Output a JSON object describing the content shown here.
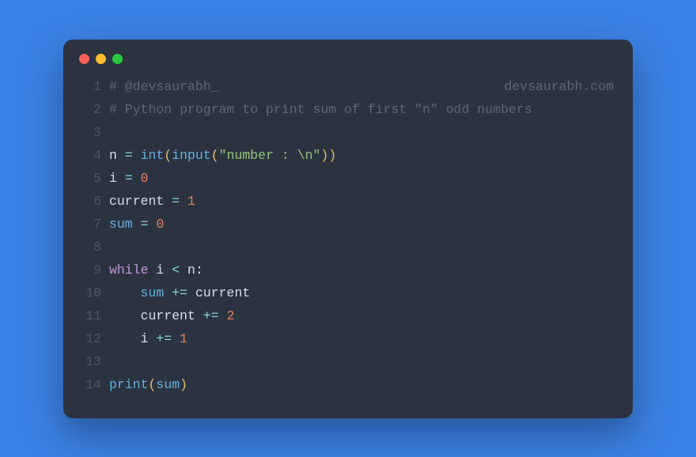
{
  "window": {
    "dots": [
      "#ff5f56",
      "#ffbd2e",
      "#27c93f"
    ]
  },
  "code": {
    "lines": [
      {
        "n": "1",
        "type": "comment_split",
        "left": "# @devsaurabh_",
        "right": "devsaurabh.com"
      },
      {
        "n": "2",
        "type": "comment",
        "text": "# Python program to print sum of first \"n\" odd numbers"
      },
      {
        "n": "3",
        "type": "blank"
      },
      {
        "n": "4",
        "type": "tokens",
        "tokens": [
          {
            "c": "ident",
            "t": "n"
          },
          {
            "c": "plain",
            "t": " "
          },
          {
            "c": "op",
            "t": "="
          },
          {
            "c": "plain",
            "t": " "
          },
          {
            "c": "func",
            "t": "int"
          },
          {
            "c": "paren",
            "t": "("
          },
          {
            "c": "func",
            "t": "input"
          },
          {
            "c": "paren",
            "t": "("
          },
          {
            "c": "str",
            "t": "\"number : \\n\""
          },
          {
            "c": "paren",
            "t": ")"
          },
          {
            "c": "paren",
            "t": ")"
          }
        ]
      },
      {
        "n": "5",
        "type": "tokens",
        "tokens": [
          {
            "c": "ident",
            "t": "i"
          },
          {
            "c": "plain",
            "t": " "
          },
          {
            "c": "op",
            "t": "="
          },
          {
            "c": "plain",
            "t": " "
          },
          {
            "c": "num",
            "t": "0"
          }
        ]
      },
      {
        "n": "6",
        "type": "tokens",
        "tokens": [
          {
            "c": "ident",
            "t": "current"
          },
          {
            "c": "plain",
            "t": " "
          },
          {
            "c": "op",
            "t": "="
          },
          {
            "c": "plain",
            "t": " "
          },
          {
            "c": "num",
            "t": "1"
          }
        ]
      },
      {
        "n": "7",
        "type": "tokens",
        "tokens": [
          {
            "c": "func",
            "t": "sum"
          },
          {
            "c": "plain",
            "t": " "
          },
          {
            "c": "op",
            "t": "="
          },
          {
            "c": "plain",
            "t": " "
          },
          {
            "c": "num",
            "t": "0"
          }
        ]
      },
      {
        "n": "8",
        "type": "blank"
      },
      {
        "n": "9",
        "type": "tokens",
        "tokens": [
          {
            "c": "kw",
            "t": "while"
          },
          {
            "c": "plain",
            "t": " "
          },
          {
            "c": "ident",
            "t": "i"
          },
          {
            "c": "plain",
            "t": " "
          },
          {
            "c": "op",
            "t": "<"
          },
          {
            "c": "plain",
            "t": " "
          },
          {
            "c": "ident",
            "t": "n"
          },
          {
            "c": "plain",
            "t": ":"
          }
        ]
      },
      {
        "n": "10",
        "type": "tokens",
        "tokens": [
          {
            "c": "plain",
            "t": "    "
          },
          {
            "c": "func",
            "t": "sum"
          },
          {
            "c": "plain",
            "t": " "
          },
          {
            "c": "op",
            "t": "+="
          },
          {
            "c": "plain",
            "t": " "
          },
          {
            "c": "ident",
            "t": "current"
          }
        ]
      },
      {
        "n": "11",
        "type": "tokens",
        "tokens": [
          {
            "c": "plain",
            "t": "    "
          },
          {
            "c": "ident",
            "t": "current"
          },
          {
            "c": "plain",
            "t": " "
          },
          {
            "c": "op",
            "t": "+="
          },
          {
            "c": "plain",
            "t": " "
          },
          {
            "c": "num",
            "t": "2"
          }
        ]
      },
      {
        "n": "12",
        "type": "tokens",
        "tokens": [
          {
            "c": "plain",
            "t": "    "
          },
          {
            "c": "ident",
            "t": "i"
          },
          {
            "c": "plain",
            "t": " "
          },
          {
            "c": "op",
            "t": "+="
          },
          {
            "c": "plain",
            "t": " "
          },
          {
            "c": "num",
            "t": "1"
          }
        ]
      },
      {
        "n": "13",
        "type": "blank"
      },
      {
        "n": "14",
        "type": "tokens",
        "tokens": [
          {
            "c": "func",
            "t": "print"
          },
          {
            "c": "paren",
            "t": "("
          },
          {
            "c": "func",
            "t": "sum"
          },
          {
            "c": "paren",
            "t": ")"
          }
        ]
      }
    ]
  }
}
